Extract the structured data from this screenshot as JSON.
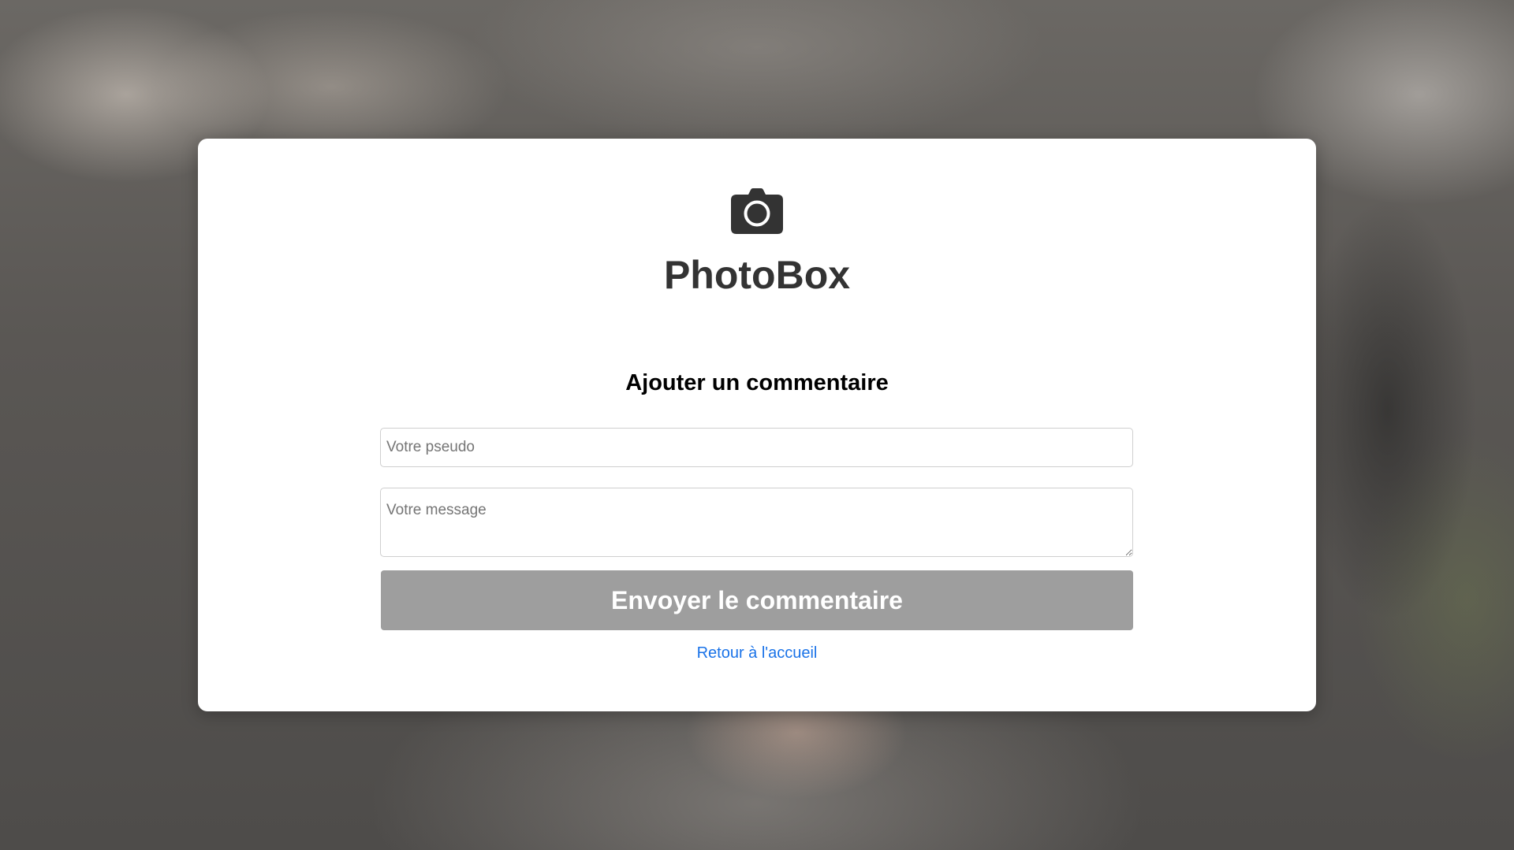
{
  "app": {
    "brand": "PhotoBox",
    "logo_icon": "camera-icon"
  },
  "form": {
    "heading": "Ajouter un commentaire",
    "pseudo_placeholder": "Votre pseudo",
    "pseudo_value": "",
    "message_placeholder": "Votre message",
    "message_value": "",
    "submit_label": "Envoyer le commentaire",
    "back_link_label": "Retour à l'accueil"
  },
  "colors": {
    "submit_button": "#9e9e9e",
    "link": "#1a73e8",
    "brand_text": "#333333"
  }
}
